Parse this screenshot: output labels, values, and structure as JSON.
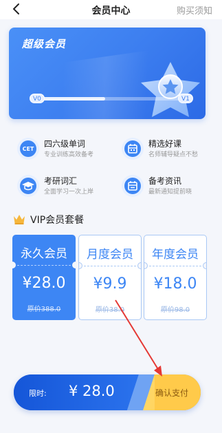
{
  "header": {
    "title": "会员中心",
    "right_link": "购买须知",
    "back_icon": "chevron-left-icon"
  },
  "card": {
    "member_name": "超级会员",
    "badge_icon": "star-badge-icon",
    "level_start": "V0",
    "level_end": "V1",
    "level_progress": 0.48
  },
  "features": [
    {
      "icon": "cet-icon",
      "icon_text": "CET",
      "title": "四六级单词",
      "subtitle": "专业训练高效备考"
    },
    {
      "icon": "calendar-book-icon",
      "title": "精选好课",
      "subtitle": "名师辅导疑点不愁"
    },
    {
      "icon": "graduation-cap-icon",
      "title": "考研词汇",
      "subtitle": "全面学习一次上岸"
    },
    {
      "icon": "calendar-icon",
      "title": "备考资讯",
      "subtitle": "最新通知提前晓"
    }
  ],
  "vip": {
    "title": "VIP会员套餐",
    "crown_icon": "crown-icon",
    "plans": [
      {
        "name": "永久会员",
        "price": "¥28.0",
        "original": "原价388.0",
        "selected": true
      },
      {
        "name": "月度会员",
        "price": "¥9.9",
        "original": "原价38.0",
        "selected": false
      },
      {
        "name": "年度会员",
        "price": "¥18.0",
        "original": "原价98.0",
        "selected": false
      }
    ]
  },
  "paybar": {
    "label": "限时:",
    "price": "¥ 28.0",
    "button": "确认支付"
  },
  "colors": {
    "primary": "#3d86f4",
    "accent_yellow": "#ffca4a",
    "arrow_red": "#e53935"
  }
}
